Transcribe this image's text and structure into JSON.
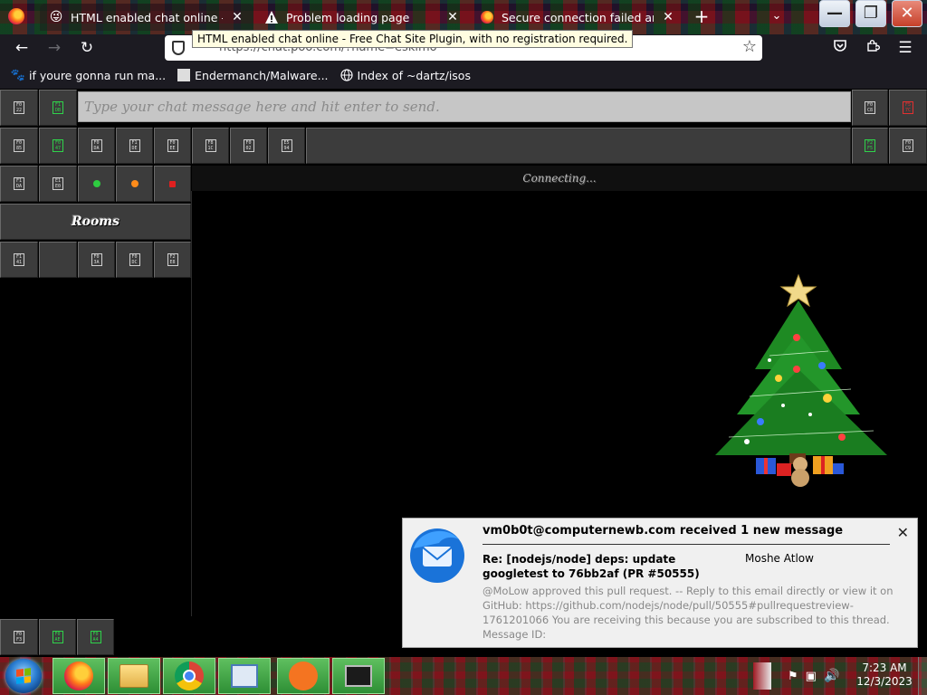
{
  "browser": {
    "tabs": [
      {
        "label": "HTML enabled chat online - Free",
        "icon": "face-emoji-icon",
        "active": true
      },
      {
        "label": "Problem loading page",
        "icon": "warning-icon",
        "active": false
      },
      {
        "label": "Secure connection failed and Firef",
        "icon": "firefox-icon",
        "active": false
      }
    ],
    "close_glyph": "✕",
    "new_tab_glyph": "+",
    "tab_list_glyph": "⌄",
    "window_buttons": {
      "minimize": "—",
      "restore": "❐",
      "close": "✕"
    },
    "url": "https://chat.poo.com/?name=eskimo",
    "tooltip": "HTML enabled chat online - Free Chat Site Plugin, with no registration required.",
    "bookmarks": [
      {
        "label": "if youre gonna run ma...",
        "icon": "bookmark-page-icon"
      },
      {
        "label": "Endermanch/Malware...",
        "icon": "github-icon"
      },
      {
        "label": "Index of ~dartz/isos",
        "icon": "globe-icon"
      }
    ]
  },
  "chat": {
    "message_placeholder": "Type your chat message here and hit enter to send.",
    "rooms_label": "Rooms",
    "status": "Connecting...",
    "top_row_left": [
      "F0\n22",
      "F1\nDB"
    ],
    "top_row_right": [
      "F0\nC8",
      "F5\n7C"
    ],
    "second_row": [
      "F0\n85",
      "F0\n47",
      "F0\nDA",
      "F1\nDE",
      "F0\nEE",
      "F8\n1C",
      "F0\n02",
      "E5\n94"
    ],
    "second_row_right": [
      "F2\nF5",
      "F0\nC9"
    ],
    "third_row": [
      "F1\nDA",
      "E1\nE0"
    ],
    "third_row_dots": [
      "#2ecc40",
      "#ff8c1a",
      "#e02020"
    ],
    "fourth_row": [
      "F1\n41",
      "",
      "F0\n3A",
      "F0\nDC",
      "F2\nE8"
    ],
    "bottom_row": [
      "F0\nF3",
      "F0\nAE",
      "F0\nA4"
    ],
    "colors": {
      "accent_green": "#2fd34a",
      "accent_red": "#e23030",
      "panel": "#3c3c3c"
    }
  },
  "notification": {
    "title": "vm0b0t@computernewb.com received 1 new message",
    "subject": "Re: [nodejs/node] deps: update googletest to 76bb2af (PR #50555)",
    "sender": "Moshe Atlow",
    "body": "@MoLow approved this pull request. -- Reply to this email directly or view it on GitHub: https://github.com/nodejs/node/pull/50555#pullrequestreview-1761201066 You are receiving this because you are subscribed to this thread. Message ID:",
    "close_glyph": "✕"
  },
  "taskbar": {
    "apps": [
      "firefox-icon",
      "file-explorer-icon",
      "chrome-icon",
      "control-panel-icon",
      "sublime-icon",
      "terminal-icon"
    ],
    "time": "7:23 AM",
    "date": "12/3/2023"
  }
}
